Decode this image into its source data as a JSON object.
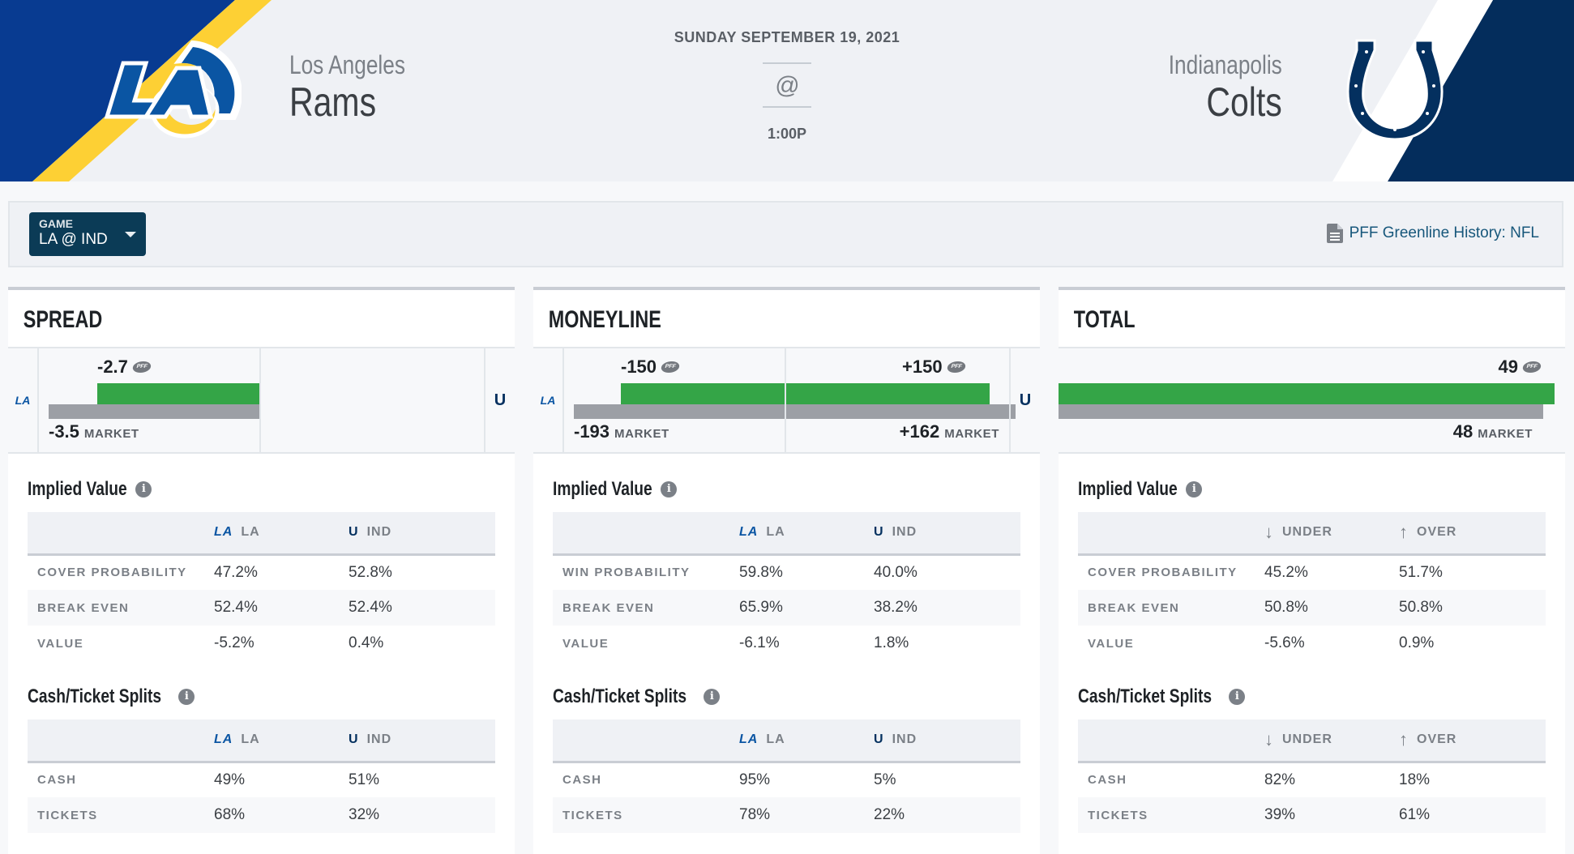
{
  "header": {
    "date": "SUNDAY SEPTEMBER 19, 2021",
    "at_symbol": "@",
    "time": "1:00P",
    "home_team": {
      "city": "Los Angeles",
      "name": "Rams",
      "abbr": "LA",
      "logo_icon": "rams-logo-icon"
    },
    "away_team": {
      "city": "Indianapolis",
      "name": "Colts",
      "abbr": "IND",
      "logo_icon": "colts-horseshoe-icon"
    },
    "colors": {
      "rams_blue": "#083b91",
      "rams_gold": "#fdd034",
      "colts_navy": "#042d5c"
    }
  },
  "toolbar": {
    "game_label": "GAME",
    "game_value": "LA @ IND",
    "history_link": "PFF Greenline History: NFL"
  },
  "cards": [
    {
      "title": "SPREAD",
      "bars": {
        "pff_home": "-2.7",
        "market_home": "-3.5",
        "market_label": "MARKET"
      },
      "implied": {
        "title": "Implied Value",
        "cols": [
          "LA",
          "IND"
        ],
        "rows": [
          {
            "label": "COVER PROBABILITY",
            "a": "47.2%",
            "b": "52.8%"
          },
          {
            "label": "BREAK EVEN",
            "a": "52.4%",
            "b": "52.4%"
          },
          {
            "label": "VALUE",
            "a": "-5.2%",
            "b": "0.4%"
          }
        ]
      },
      "splits": {
        "title": "Cash/Ticket Splits",
        "cols": [
          "LA",
          "IND"
        ],
        "rows": [
          {
            "label": "CASH",
            "a": "49%",
            "b": "51%"
          },
          {
            "label": "TICKETS",
            "a": "68%",
            "b": "32%"
          }
        ]
      }
    },
    {
      "title": "MONEYLINE",
      "bars": {
        "pff_home": "-150",
        "pff_away": "+150",
        "market_home": "-193",
        "market_away": "+162",
        "market_label": "MARKET"
      },
      "implied": {
        "title": "Implied Value",
        "cols": [
          "LA",
          "IND"
        ],
        "rows": [
          {
            "label": "WIN PROBABILITY",
            "a": "59.8%",
            "b": "40.0%"
          },
          {
            "label": "BREAK EVEN",
            "a": "65.9%",
            "b": "38.2%"
          },
          {
            "label": "VALUE",
            "a": "-6.1%",
            "b": "1.8%"
          }
        ]
      },
      "splits": {
        "title": "Cash/Ticket Splits",
        "cols": [
          "LA",
          "IND"
        ],
        "rows": [
          {
            "label": "CASH",
            "a": "95%",
            "b": "5%"
          },
          {
            "label": "TICKETS",
            "a": "78%",
            "b": "22%"
          }
        ]
      }
    },
    {
      "title": "TOTAL",
      "bars": {
        "pff_total": "49",
        "market_total": "48",
        "market_label": "MARKET"
      },
      "implied": {
        "title": "Implied Value",
        "cols": [
          "UNDER",
          "OVER"
        ],
        "rows": [
          {
            "label": "COVER PROBABILITY",
            "a": "45.2%",
            "b": "51.7%"
          },
          {
            "label": "BREAK EVEN",
            "a": "50.8%",
            "b": "50.8%"
          },
          {
            "label": "VALUE",
            "a": "-5.6%",
            "b": "0.9%"
          }
        ]
      },
      "splits": {
        "title": "Cash/Ticket Splits",
        "cols": [
          "UNDER",
          "OVER"
        ],
        "rows": [
          {
            "label": "CASH",
            "a": "82%",
            "b": "18%"
          },
          {
            "label": "TICKETS",
            "a": "39%",
            "b": "61%"
          }
        ]
      }
    }
  ]
}
